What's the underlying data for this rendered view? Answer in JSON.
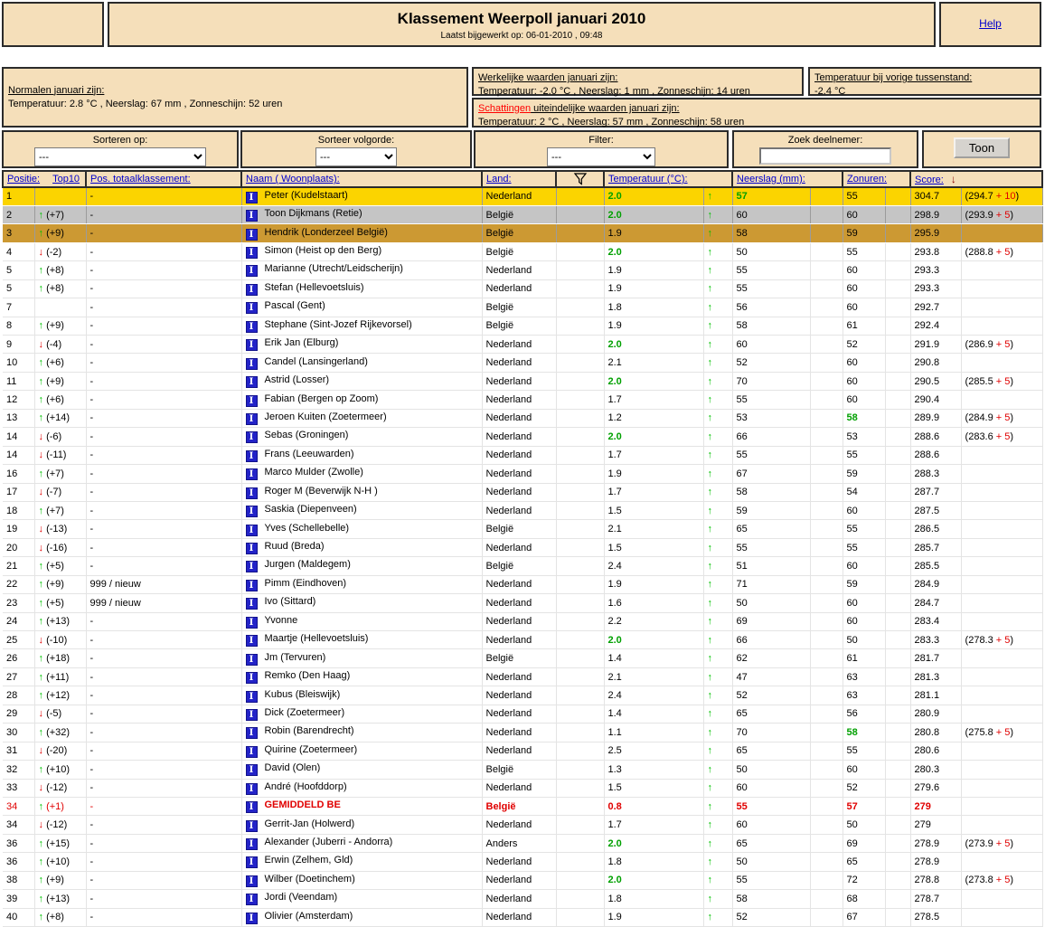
{
  "header": {
    "title": "Klassement Weerpoll januari 2010",
    "subtitle": "Laatst bijgewerkt op: 06-01-2010 , 09:48",
    "help": "Help"
  },
  "info": {
    "normalen": {
      "title": "Normalen januari zijn:",
      "values": "Temperatuur: 2.8 °C , Neerslag: 67 mm , Zonneschijn: 52 uren"
    },
    "werkelijk": {
      "title": "Werkelijke waarden januari zijn:",
      "values": "Temperatuur: -2.0 °C , Neerslag: 1 mm , Zonneschijn: 14 uren"
    },
    "vorige": {
      "title": "Temperatuur bij vorige tussenstand:",
      "value": "-2.4 °C"
    },
    "schattingen": {
      "title_red": "Schattingen",
      "title_rest": " uiteindelijke waarden januari zijn:",
      "values": "Temperatuur: 2 °C , Neerslag: 57 mm , Zonneschijn: 58 uren"
    }
  },
  "filters": {
    "sort_label": "Sorteren op:",
    "sort_value": "---",
    "order_label": "Sorteer volgorde:",
    "order_value": "---",
    "filter_label": "Filter:",
    "filter_value": "---",
    "search_label": "Zoek deelnemer:",
    "search_value": "",
    "show_button": "Toon"
  },
  "table": {
    "headers": {
      "positie": "Positie:",
      "top10": "Top10",
      "total": "Pos. totaalklassement:",
      "naam": "Naam ( Woonplaats):",
      "land": "Land:",
      "temp": "Temperatuur (°C):",
      "rain": "Neerslag (mm):",
      "sun": "Zonuren:",
      "score": "Score:",
      "score_sort_arrow": "↓"
    },
    "icons": {
      "name_icon_glyph": "I",
      "up_arrow": "↑",
      "down_arrow": "↓"
    },
    "rows": [
      {
        "pos": "1",
        "dir": "",
        "delta": "",
        "total": "-",
        "name": "Peter (Kudelstaart)",
        "land": "Nederland",
        "temp": "2.0",
        "thl": 1,
        "rain": "57",
        "rhl": 1,
        "sun": "55",
        "score": "304.7",
        "bb": "294.7",
        "ba": "10",
        "cls": "gold"
      },
      {
        "pos": "2",
        "dir": "up",
        "delta": "(+7)",
        "total": "-",
        "name": "Toon Dijkmans (Retie)",
        "land": "België",
        "temp": "2.0",
        "thl": 1,
        "rain": "60",
        "sun": "60",
        "score": "298.9",
        "bb": "293.9",
        "ba": "5",
        "cls": "silver"
      },
      {
        "pos": "3",
        "dir": "up",
        "delta": "(+9)",
        "total": "-",
        "name": "Hendrik (Londerzeel België)",
        "land": "België",
        "temp": "1.9",
        "rain": "58",
        "sun": "59",
        "score": "295.9",
        "cls": "bronze"
      },
      {
        "pos": "4",
        "dir": "down",
        "delta": "(-2)",
        "total": "-",
        "name": "Simon (Heist op den Berg)",
        "land": "België",
        "temp": "2.0",
        "thl": 1,
        "rain": "50",
        "sun": "55",
        "score": "293.8",
        "bb": "288.8",
        "ba": "5"
      },
      {
        "pos": "5",
        "dir": "up",
        "delta": "(+8)",
        "total": "-",
        "name": "Marianne (Utrecht/Leidscherijn)",
        "land": "Nederland",
        "temp": "1.9",
        "rain": "55",
        "sun": "60",
        "score": "293.3"
      },
      {
        "pos": "5",
        "dir": "up",
        "delta": "(+8)",
        "total": "-",
        "name": "Stefan (Hellevoetsluis)",
        "land": "Nederland",
        "temp": "1.9",
        "rain": "55",
        "sun": "60",
        "score": "293.3"
      },
      {
        "pos": "7",
        "dir": "",
        "delta": "",
        "total": "-",
        "name": "Pascal (Gent)",
        "land": "België",
        "temp": "1.8",
        "rain": "56",
        "sun": "60",
        "score": "292.7"
      },
      {
        "pos": "8",
        "dir": "up",
        "delta": "(+9)",
        "total": "-",
        "name": "Stephane (Sint-Jozef Rijkevorsel)",
        "land": "België",
        "temp": "1.9",
        "rain": "58",
        "sun": "61",
        "score": "292.4"
      },
      {
        "pos": "9",
        "dir": "down",
        "delta": "(-4)",
        "total": "-",
        "name": "Erik Jan (Elburg)",
        "land": "Nederland",
        "temp": "2.0",
        "thl": 1,
        "rain": "60",
        "sun": "52",
        "score": "291.9",
        "bb": "286.9",
        "ba": "5"
      },
      {
        "pos": "10",
        "dir": "up",
        "delta": "(+6)",
        "total": "-",
        "name": "Candel (Lansingerland)",
        "land": "Nederland",
        "temp": "2.1",
        "rain": "52",
        "sun": "60",
        "score": "290.8"
      },
      {
        "pos": "11",
        "dir": "up",
        "delta": "(+9)",
        "total": "-",
        "name": "Astrid (Losser)",
        "land": "Nederland",
        "temp": "2.0",
        "thl": 1,
        "rain": "70",
        "sun": "60",
        "score": "290.5",
        "bb": "285.5",
        "ba": "5"
      },
      {
        "pos": "12",
        "dir": "up",
        "delta": "(+6)",
        "total": "-",
        "name": "Fabian (Bergen op Zoom)",
        "land": "Nederland",
        "temp": "1.7",
        "rain": "55",
        "sun": "60",
        "score": "290.4"
      },
      {
        "pos": "13",
        "dir": "up",
        "delta": "(+14)",
        "total": "-",
        "name": "Jeroen Kuiten (Zoetermeer)",
        "land": "Nederland",
        "temp": "1.2",
        "rain": "53",
        "sun": "58",
        "shl": 1,
        "score": "289.9",
        "bb": "284.9",
        "ba": "5"
      },
      {
        "pos": "14",
        "dir": "down",
        "delta": "(-6)",
        "total": "-",
        "name": "Sebas (Groningen)",
        "land": "Nederland",
        "temp": "2.0",
        "thl": 1,
        "rain": "66",
        "sun": "53",
        "score": "288.6",
        "bb": "283.6",
        "ba": "5"
      },
      {
        "pos": "14",
        "dir": "down",
        "delta": "(-11)",
        "total": "-",
        "name": "Frans (Leeuwarden)",
        "land": "Nederland",
        "temp": "1.7",
        "rain": "55",
        "sun": "55",
        "score": "288.6"
      },
      {
        "pos": "16",
        "dir": "up",
        "delta": "(+7)",
        "total": "-",
        "name": "Marco Mulder (Zwolle)",
        "land": "Nederland",
        "temp": "1.9",
        "rain": "67",
        "sun": "59",
        "score": "288.3"
      },
      {
        "pos": "17",
        "dir": "down",
        "delta": "(-7)",
        "total": "-",
        "name": "Roger M (Beverwijk N-H )",
        "land": "Nederland",
        "temp": "1.7",
        "rain": "58",
        "sun": "54",
        "score": "287.7"
      },
      {
        "pos": "18",
        "dir": "up",
        "delta": "(+7)",
        "total": "-",
        "name": "Saskia (Diepenveen)",
        "land": "Nederland",
        "temp": "1.5",
        "rain": "59",
        "sun": "60",
        "score": "287.5"
      },
      {
        "pos": "19",
        "dir": "down",
        "delta": "(-13)",
        "total": "-",
        "name": "Yves (Schellebelle)",
        "land": "België",
        "temp": "2.1",
        "rain": "65",
        "sun": "55",
        "score": "286.5"
      },
      {
        "pos": "20",
        "dir": "down",
        "delta": "(-16)",
        "total": "-",
        "name": "Ruud (Breda)",
        "land": "Nederland",
        "temp": "1.5",
        "rain": "55",
        "sun": "55",
        "score": "285.7"
      },
      {
        "pos": "21",
        "dir": "up",
        "delta": "(+5)",
        "total": "-",
        "name": "Jurgen (Maldegem)",
        "land": "België",
        "temp": "2.4",
        "rain": "51",
        "sun": "60",
        "score": "285.5"
      },
      {
        "pos": "22",
        "dir": "up",
        "delta": "(+9)",
        "total": "999 / nieuw",
        "name": "Pimm (Eindhoven)",
        "land": "Nederland",
        "temp": "1.9",
        "rain": "71",
        "sun": "59",
        "score": "284.9"
      },
      {
        "pos": "23",
        "dir": "up",
        "delta": "(+5)",
        "total": "999 / nieuw",
        "name": "Ivo (Sittard)",
        "land": "Nederland",
        "temp": "1.6",
        "rain": "50",
        "sun": "60",
        "score": "284.7"
      },
      {
        "pos": "24",
        "dir": "up",
        "delta": "(+13)",
        "total": "-",
        "name": "Yvonne",
        "land": "Nederland",
        "temp": "2.2",
        "rain": "69",
        "sun": "60",
        "score": "283.4"
      },
      {
        "pos": "25",
        "dir": "down",
        "delta": "(-10)",
        "total": "-",
        "name": "Maartje (Hellevoetsluis)",
        "land": "Nederland",
        "temp": "2.0",
        "thl": 1,
        "rain": "66",
        "sun": "50",
        "score": "283.3",
        "bb": "278.3",
        "ba": "5"
      },
      {
        "pos": "26",
        "dir": "up",
        "delta": "(+18)",
        "total": "-",
        "name": "Jm (Tervuren)",
        "land": "België",
        "temp": "1.4",
        "rain": "62",
        "sun": "61",
        "score": "281.7"
      },
      {
        "pos": "27",
        "dir": "up",
        "delta": "(+11)",
        "total": "-",
        "name": "Remko (Den Haag)",
        "land": "Nederland",
        "temp": "2.1",
        "rain": "47",
        "sun": "63",
        "score": "281.3"
      },
      {
        "pos": "28",
        "dir": "up",
        "delta": "(+12)",
        "total": "-",
        "name": "Kubus (Bleiswijk)",
        "land": "Nederland",
        "temp": "2.4",
        "rain": "52",
        "sun": "63",
        "score": "281.1"
      },
      {
        "pos": "29",
        "dir": "down",
        "delta": "(-5)",
        "total": "-",
        "name": "Dick (Zoetermeer)",
        "land": "Nederland",
        "temp": "1.4",
        "rain": "65",
        "sun": "56",
        "score": "280.9"
      },
      {
        "pos": "30",
        "dir": "up",
        "delta": "(+32)",
        "total": "-",
        "name": "Robin (Barendrecht)",
        "land": "Nederland",
        "temp": "1.1",
        "rain": "70",
        "sun": "58",
        "shl": 1,
        "score": "280.8",
        "bb": "275.8",
        "ba": "5"
      },
      {
        "pos": "31",
        "dir": "down",
        "delta": "(-20)",
        "total": "-",
        "name": "Quirine (Zoetermeer)",
        "land": "Nederland",
        "temp": "2.5",
        "rain": "65",
        "sun": "55",
        "score": "280.6"
      },
      {
        "pos": "32",
        "dir": "up",
        "delta": "(+10)",
        "total": "-",
        "name": "David (Olen)",
        "land": "België",
        "temp": "1.3",
        "rain": "50",
        "sun": "60",
        "score": "280.3"
      },
      {
        "pos": "33",
        "dir": "down",
        "delta": "(-12)",
        "total": "-",
        "name": "André (Hoofddorp)",
        "land": "Nederland",
        "temp": "1.5",
        "rain": "60",
        "sun": "52",
        "score": "279.6"
      },
      {
        "pos": "34",
        "dir": "up",
        "delta": "(+1)",
        "total": "-",
        "name": "GEMIDDELD BE",
        "land": "België",
        "temp": "0.8",
        "rain": "55",
        "sun": "57",
        "score": "279",
        "cls": "avg"
      },
      {
        "pos": "34",
        "dir": "down",
        "delta": "(-12)",
        "total": "-",
        "name": "Gerrit-Jan (Holwerd)",
        "land": "Nederland",
        "temp": "1.7",
        "rain": "60",
        "sun": "50",
        "score": "279"
      },
      {
        "pos": "36",
        "dir": "up",
        "delta": "(+15)",
        "total": "-",
        "name": "Alexander (Juberri - Andorra)",
        "land": "Anders",
        "temp": "2.0",
        "thl": 1,
        "rain": "65",
        "sun": "69",
        "score": "278.9",
        "bb": "273.9",
        "ba": "5"
      },
      {
        "pos": "36",
        "dir": "up",
        "delta": "(+10)",
        "total": "-",
        "name": "Erwin (Zelhem, Gld)",
        "land": "Nederland",
        "temp": "1.8",
        "rain": "50",
        "sun": "65",
        "score": "278.9"
      },
      {
        "pos": "38",
        "dir": "up",
        "delta": "(+9)",
        "total": "-",
        "name": "Wilber (Doetinchem)",
        "land": "Nederland",
        "temp": "2.0",
        "thl": 1,
        "rain": "55",
        "sun": "72",
        "score": "278.8",
        "bb": "273.8",
        "ba": "5"
      },
      {
        "pos": "39",
        "dir": "up",
        "delta": "(+13)",
        "total": "-",
        "name": "Jordi (Veendam)",
        "land": "Nederland",
        "temp": "1.8",
        "rain": "58",
        "sun": "68",
        "score": "278.7"
      },
      {
        "pos": "40",
        "dir": "up",
        "delta": "(+8)",
        "total": "-",
        "name": "Olivier (Amsterdam)",
        "land": "Nederland",
        "temp": "1.9",
        "rain": "52",
        "sun": "67",
        "score": "278.5"
      }
    ]
  },
  "colors": {
    "panel_tan": "#f5dfba",
    "rank1_gold": "#fbd400",
    "rank2_silver": "#c5c5c5",
    "rank3_bronze": "#cc9933",
    "link_blue": "#0000cc",
    "match_green": "#00a000",
    "alert_red": "#e00000",
    "sort_arrow_darkred": "#8b0000",
    "name_icon_blue": "#2323c8"
  }
}
